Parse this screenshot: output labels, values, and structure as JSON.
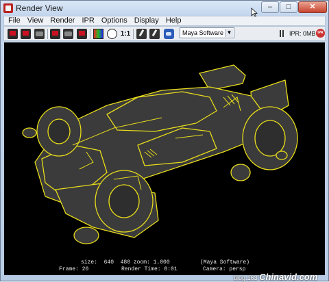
{
  "window": {
    "title": "Render View"
  },
  "menu": [
    "File",
    "View",
    "Render",
    "IPR",
    "Options",
    "Display",
    "Help"
  ],
  "toolbar": {
    "ratio_label": "1:1",
    "renderer": "Maya Software",
    "ipr_memory": "IPR: 0MB",
    "ipr_badge": "IPR"
  },
  "status": {
    "line1": "size:  640  480 zoom: 1.000",
    "line1b": "(Maya Software)",
    "frame": "Frame: 20",
    "render_time": "Render Time: 0:01",
    "camera": "Camera: persp"
  },
  "watermark": {
    "prefix": "blog.163",
    "brand": "Chinavid.com"
  },
  "colors": {
    "outline": "#e8dc1a",
    "body": "#3a3a3a",
    "background": "#000000"
  }
}
